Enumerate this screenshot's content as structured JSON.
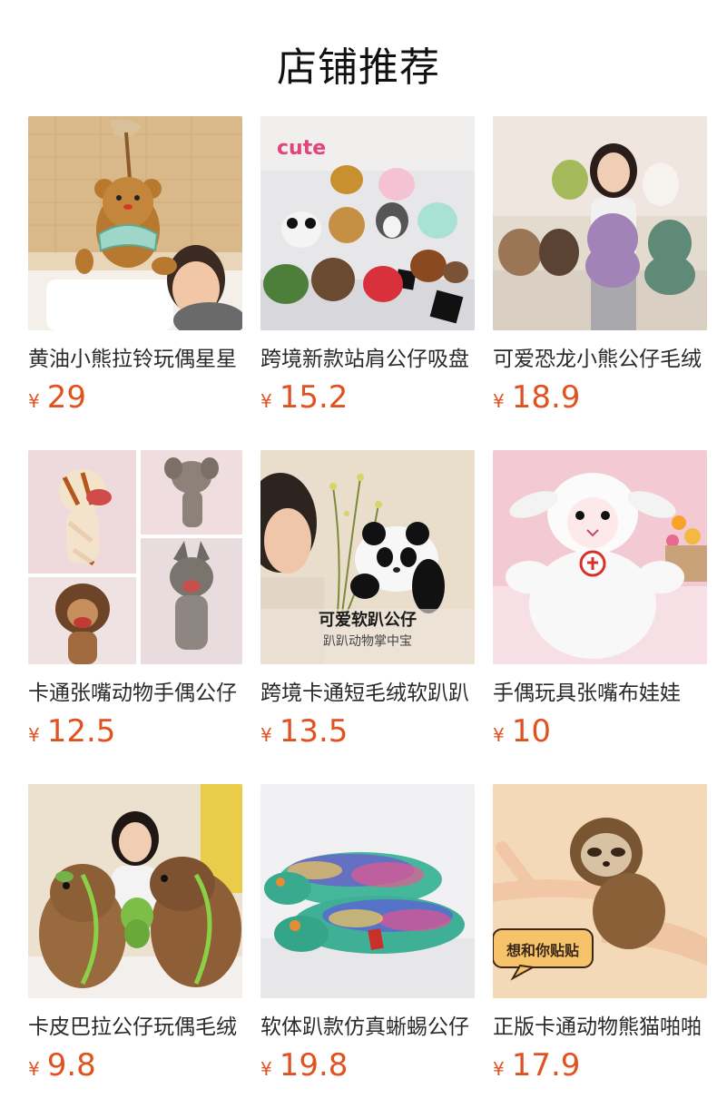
{
  "section_title": "店铺推荐",
  "currency_symbol": "¥",
  "products": [
    {
      "name": "黄油小熊拉铃玩偶星星",
      "price": "29",
      "image": "bear-pull-toy-photo"
    },
    {
      "name": "跨境新款站肩公仔吸盘",
      "price": "15.2",
      "image": "shoulder-plush-set-photo"
    },
    {
      "name": "可爱恐龙小熊公仔毛绒",
      "price": "18.9",
      "image": "dinosaur-bear-plush-photo"
    },
    {
      "name": "卡通张嘴动物手偶公仔",
      "price": "12.5",
      "image": "hand-puppet-animals-photo"
    },
    {
      "name": "跨境卡通短毛绒软趴趴",
      "price": "13.5",
      "image": "panda-plush-photo",
      "overlay_title": "可爱软趴公仔",
      "overlay_subtitle": "趴趴动物掌中宝"
    },
    {
      "name": "手偶玩具张嘴布娃娃",
      "price": "10",
      "image": "lamb-puppet-photo"
    },
    {
      "name": "卡皮巴拉公仔玩偶毛绒",
      "price": "9.8",
      "image": "capybara-plush-photo"
    },
    {
      "name": "软体趴款仿真蜥蜴公仔",
      "price": "19.8",
      "image": "lizard-plush-photo"
    },
    {
      "name": "正版卡通动物熊猫啪啪",
      "price": "17.9",
      "image": "sloth-slap-band-photo",
      "overlay_title": "想和你贴贴"
    }
  ]
}
